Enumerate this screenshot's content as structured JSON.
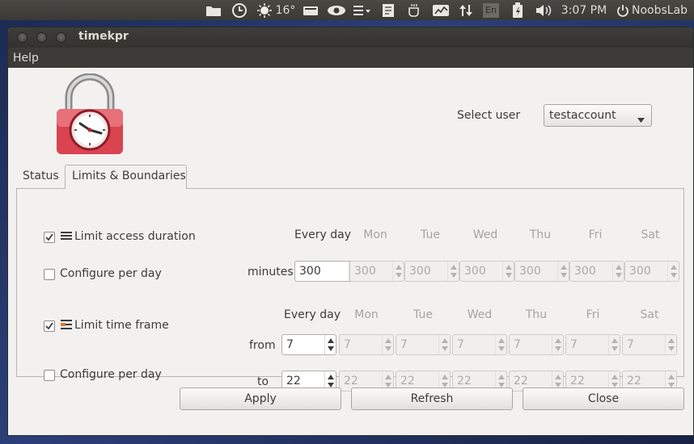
{
  "top_panel": {
    "temperature": "16°",
    "lang": "En",
    "time": "3:07 PM",
    "user": "NoobsLab",
    "icons": [
      "folder-icon",
      "clock-icon",
      "weather-sun-icon",
      "drive-icon",
      "eye-icon",
      "menu-list-icon",
      "note-icon",
      "tea-icon",
      "system-monitor-icon",
      "network-arrows-icon",
      "keyboard-lang-icon",
      "battery-icon",
      "volume-icon",
      "power-icon"
    ]
  },
  "window": {
    "title": "timekpr",
    "menu_help": "Help"
  },
  "user_select": {
    "label": "Select user",
    "value": "testaccount"
  },
  "tabs": {
    "status": "Status",
    "limits": "Limits & Boundaries"
  },
  "limits": {
    "limit_access_label": "Limit access duration",
    "limit_access_checked": true,
    "configure_per_day_1": "Configure per day",
    "configure_per_day_1_checked": false,
    "minutes_label": "minutes",
    "days": [
      "Every day",
      "Mon",
      "Tue",
      "Wed",
      "Thu",
      "Fri",
      "Sat"
    ],
    "minutes": [
      "300",
      "300",
      "300",
      "300",
      "300",
      "300",
      "300"
    ],
    "limit_time_label": "Limit time frame",
    "limit_time_checked": true,
    "configure_per_day_2": "Configure per day",
    "configure_per_day_2_checked": false,
    "from_label": "from",
    "to_label": "to",
    "from": [
      "7",
      "7",
      "7",
      "7",
      "7",
      "7",
      "7"
    ],
    "to": [
      "22",
      "22",
      "22",
      "22",
      "22",
      "22",
      "22"
    ]
  },
  "buttons": {
    "apply": "Apply",
    "refresh": "Refresh",
    "close": "Close"
  },
  "colors": {
    "panel_bg": "#3c3b37",
    "window_bg": "#f2f1f0",
    "lock_red": "#e0505a"
  }
}
